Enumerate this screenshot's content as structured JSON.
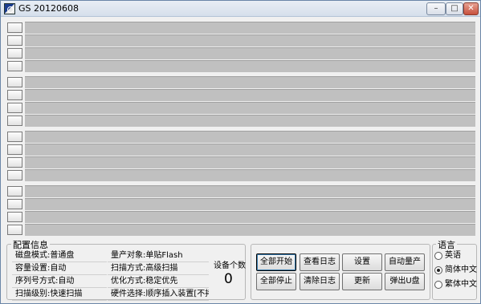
{
  "window": {
    "title": "GS  20120608",
    "controls": [
      "minimize-icon",
      "maximize-icon",
      "close-icon"
    ]
  },
  "ports": {
    "groups": 4,
    "rows_per_group": 4,
    "bar_color": "#c0c0c0"
  },
  "config": {
    "title": "配置信息",
    "left": [
      "磁盘模式:普通盘",
      "容量设置:自动",
      "序列号方式:自动",
      "扫描级别:快速扫描"
    ],
    "right": [
      "量产对象:单贴Flash",
      "扫描方式:高级扫描",
      "优化方式:稳定优先",
      "硬件选择:顺序插入装置[不拷贝"
    ],
    "device_count_label": "设备个数",
    "device_count_value": "0"
  },
  "actions": {
    "row1": [
      "全部开始",
      "查看日志",
      "设置",
      "自动量产"
    ],
    "row2": [
      "全部停止",
      "清除日志",
      "更新",
      "弹出U盘"
    ]
  },
  "language": {
    "title": "语言",
    "options": [
      {
        "label": "英语",
        "checked": false
      },
      {
        "label": "简体中文",
        "checked": true
      },
      {
        "label": "繁体中文",
        "checked": false
      }
    ]
  }
}
